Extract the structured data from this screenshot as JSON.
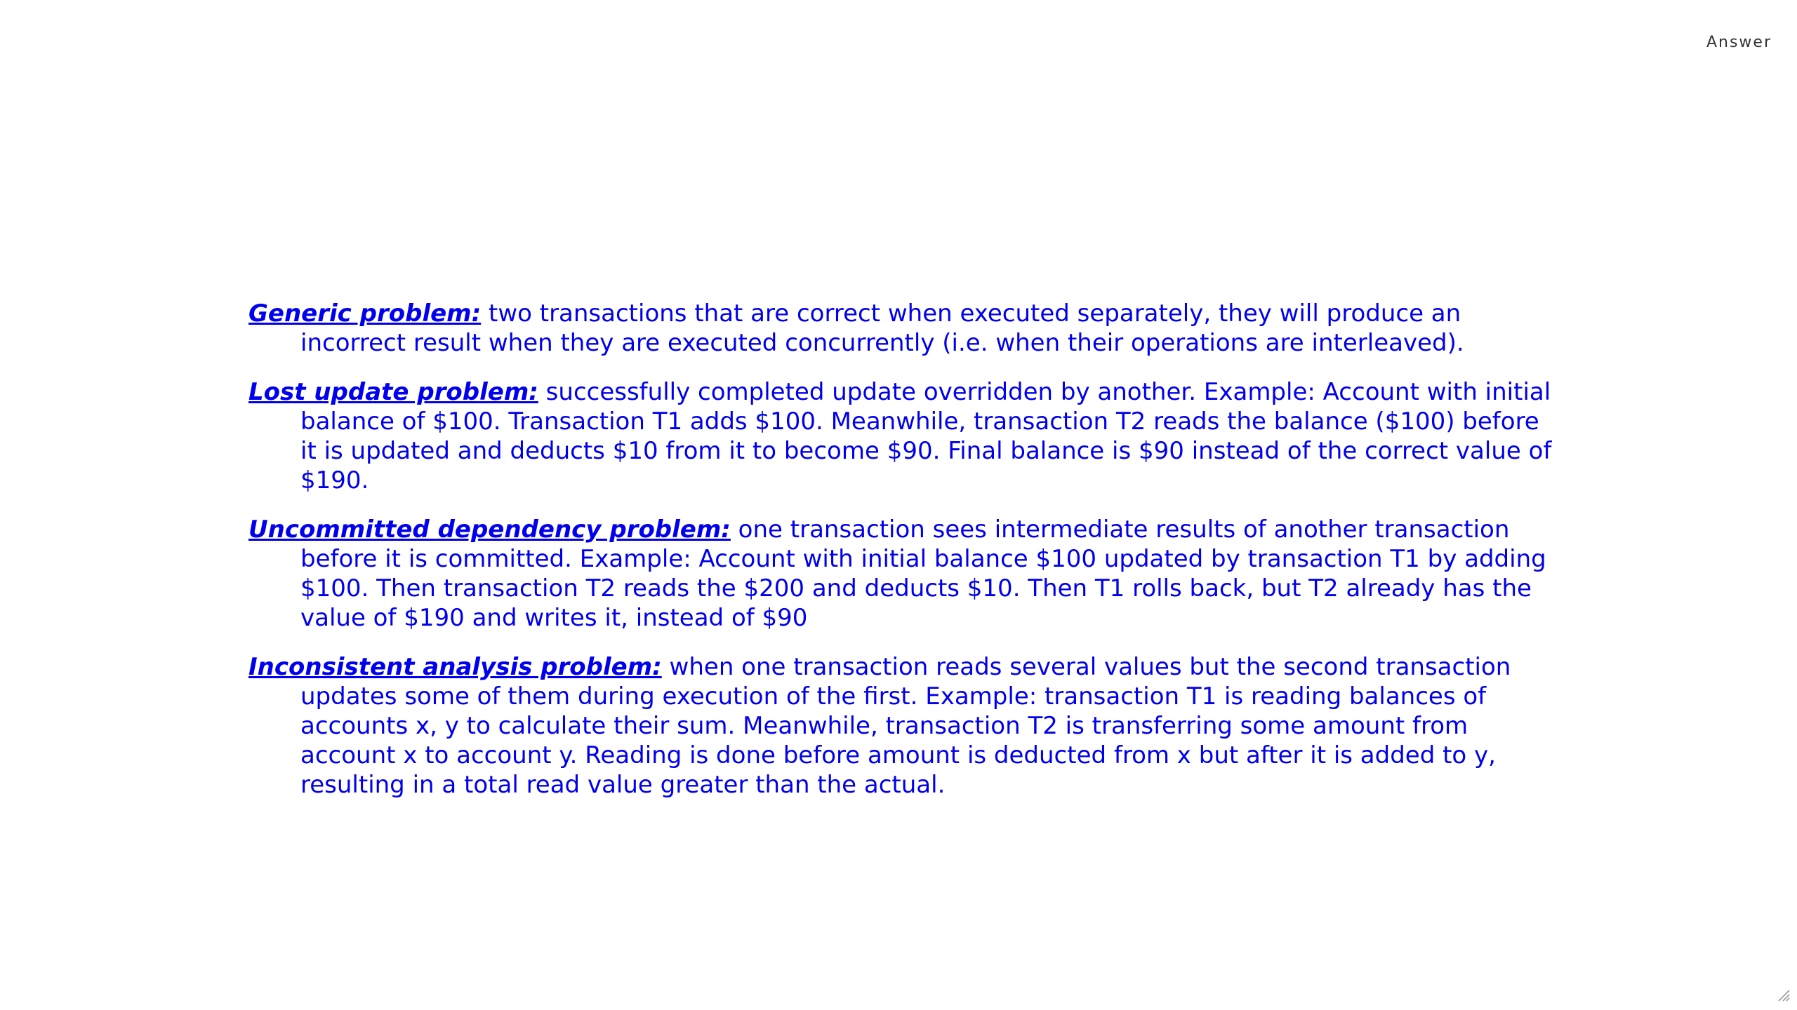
{
  "header": {
    "label": "Answer"
  },
  "problems": [
    {
      "term": "Generic problem:",
      "text": " two transactions that are correct when executed separately, they will produce an incorrect result when they are executed concurrently (i.e. when their operations are interleaved)."
    },
    {
      "term": "Lost update problem:",
      "text": " successfully completed update overridden by another. Example: Account with initial balance of $100. Transaction T1 adds $100. Meanwhile, transaction T2 reads the balance ($100) before it is updated and deducts $10 from it to become $90. Final balance is $90 instead of the correct value of $190."
    },
    {
      "term": "Uncommitted dependency problem:",
      "text": " one transaction sees intermediate results of another transaction before it is committed. Example: Account with initial balance $100 updated by transaction T1 by adding $100. Then transaction T2 reads the $200 and deducts $10. Then T1 rolls back, but T2 already has the value of $190 and writes it, instead of $90"
    },
    {
      "term": "Inconsistent analysis problem:",
      "text": " when one transaction reads several values but the second transaction updates some of them during execution of the first. Example: transaction T1 is reading balances of accounts x, y to calculate their sum. Meanwhile, transaction T2 is transferring some amount from account x to account y. Reading is done before amount is deducted from x but after it is added to y, resulting in a total read value greater than the actual."
    }
  ],
  "colors": {
    "text": "#0000ee",
    "label": "#333333",
    "background": "#ffffff"
  },
  "icons": {
    "resize": "resize-grip-icon"
  }
}
